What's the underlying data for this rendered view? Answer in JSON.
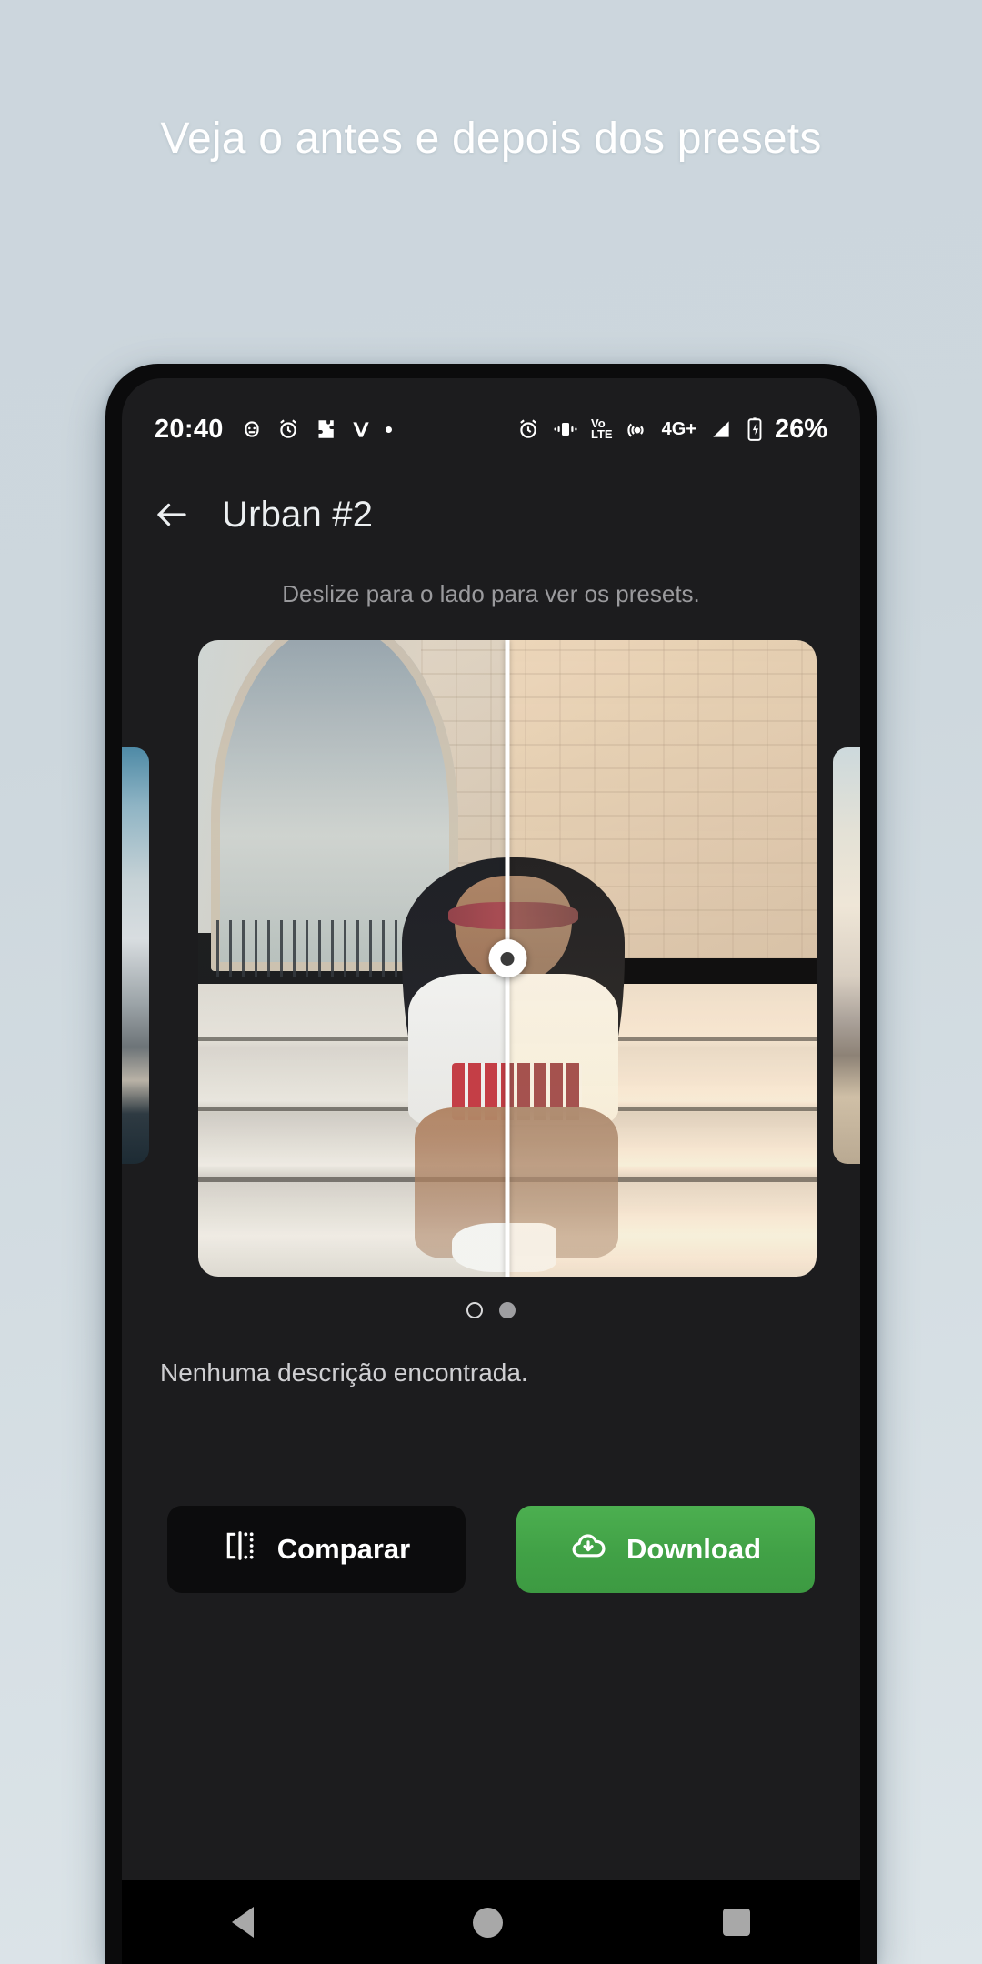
{
  "promo": {
    "headline": "Veja o antes e depois dos presets"
  },
  "statusbar": {
    "time": "20:40",
    "battery_percent": "26%",
    "network_label": "4G+",
    "volte_top": "Vo",
    "volte_bottom": "LTE",
    "left_icons": [
      "usb-icon",
      "alarm-icon",
      "puzzle-icon",
      "v-app-icon",
      "dot-icon"
    ],
    "right_icons": [
      "alarm-icon",
      "vibrate-icon",
      "volte-icon",
      "hotspot-icon",
      "network-4gplus-icon",
      "signal-icon",
      "battery-charging-icon"
    ]
  },
  "appbar": {
    "back_icon": "arrow-left-icon",
    "title": "Urban #2"
  },
  "content": {
    "hint": "Deslize para o lado para ver os presets.",
    "description": "Nenhuma descrição encontrada.",
    "slider_position_percent": 50,
    "pagination": [
      {
        "state": "inactive"
      },
      {
        "state": "active"
      }
    ]
  },
  "actions": {
    "compare": {
      "label": "Comparar",
      "icon": "compare-split-icon"
    },
    "download": {
      "label": "Download",
      "icon": "cloud-download-icon"
    }
  },
  "navbar": {
    "back": "nav-back-icon",
    "home": "nav-home-icon",
    "recents": "nav-recents-icon"
  },
  "colors": {
    "background_top": "#ccd6dd",
    "background_bottom": "#dde5e9",
    "app_surface": "#1c1c1e",
    "download_green": "#4caf50",
    "compare_dark": "#0c0c0d"
  }
}
